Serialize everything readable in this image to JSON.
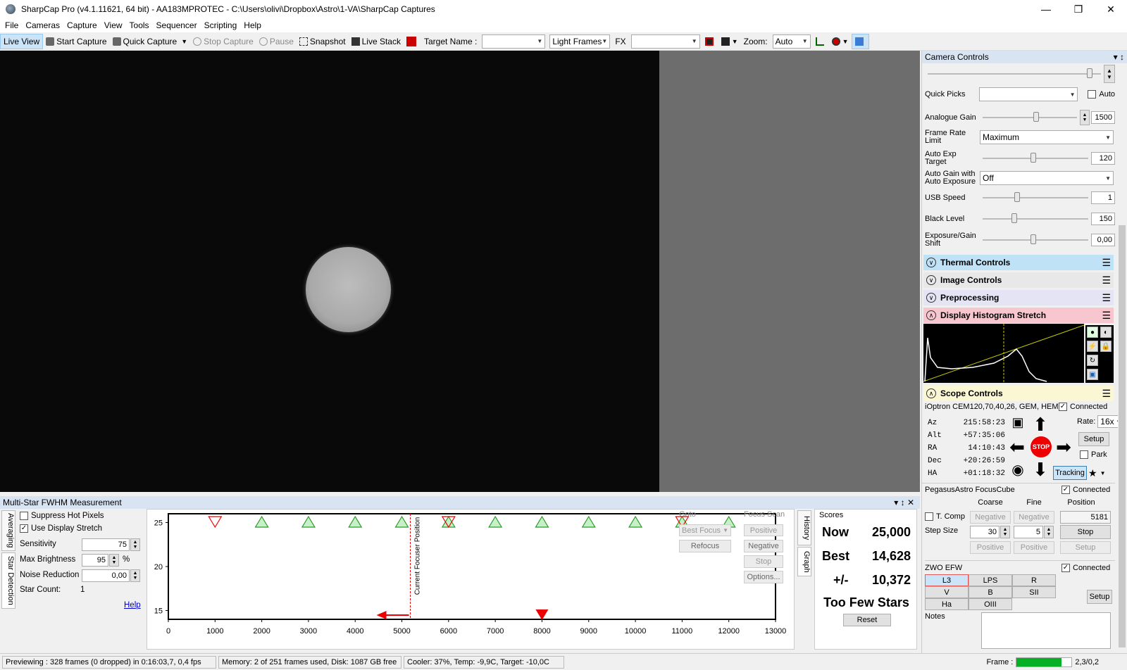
{
  "window": {
    "title": "SharpCap Pro (v4.1.11621, 64 bit) - AA183MPROTEC - C:\\Users\\olivi\\Dropbox\\Astro\\1-VA\\SharpCap Captures"
  },
  "menu": [
    "File",
    "Cameras",
    "Capture",
    "View",
    "Tools",
    "Sequencer",
    "Scripting",
    "Help"
  ],
  "toolbar": {
    "live_view": "Live View",
    "start_capture": "Start Capture",
    "quick_capture": "Quick Capture",
    "stop_capture": "Stop Capture",
    "pause": "Pause",
    "snapshot": "Snapshot",
    "live_stack": "Live Stack",
    "target_name_label": "Target Name :",
    "target_name_value": "",
    "frame_type": "Light Frames",
    "fx_label": "FX",
    "fx_value": "",
    "zoom_label": "Zoom:",
    "zoom_value": "Auto"
  },
  "camera_controls": {
    "title": "Camera Controls",
    "quick_picks_label": "Quick Picks",
    "auto_label": "Auto",
    "rows": [
      {
        "label": "Analogue Gain",
        "value": "1500",
        "level": 0.6
      },
      {
        "label": "Auto Exp Target",
        "value": "120",
        "level": 0.5
      },
      {
        "label": "USB Speed",
        "value": "1",
        "level": 0.33
      },
      {
        "label": "Black Level",
        "value": "150",
        "level": 0.3
      },
      {
        "label": "Exposure/Gain Shift",
        "value": "0,00",
        "level": 0.5
      }
    ],
    "frame_rate_label": "Frame Rate Limit",
    "frame_rate_value": "Maximum",
    "auto_gain_label": "Auto Gain with Auto Exposure",
    "auto_gain_value": "Off"
  },
  "sections": {
    "thermal": "Thermal Controls",
    "image": "Image Controls",
    "preprocessing": "Preprocessing",
    "histogram": "Display Histogram Stretch",
    "scope": "Scope Controls"
  },
  "scope": {
    "mount": "iOptron CEM120,70,40,26, GEM, HEM",
    "connected": "Connected",
    "az_label": "Az",
    "az": "215:58:23",
    "alt_label": "Alt",
    "alt": "+57:35:06",
    "ra_label": "RA",
    "ra": "14:10:43",
    "dec_label": "Dec",
    "dec": "+20:26:59",
    "ha_label": "HA",
    "ha": "+01:18:32",
    "rate_label": "Rate:",
    "rate": "16x",
    "setup": "Setup",
    "park": "Park",
    "tracking": "Tracking",
    "stop": "STOP"
  },
  "focuser": {
    "name": "PegasusAstro FocusCube",
    "connected": "Connected",
    "coarse": "Coarse",
    "fine": "Fine",
    "position_label": "Position",
    "tcomp": "T. Comp",
    "negative": "Negative",
    "positive": "Positive",
    "position": "5181",
    "step_size_label": "Step Size",
    "coarse_step": "30",
    "fine_step": "5",
    "stop": "Stop",
    "setup": "Setup"
  },
  "filter_wheel": {
    "name": "ZWO EFW",
    "connected": "Connected",
    "filters": [
      "L3",
      "LPS",
      "R",
      "V",
      "B",
      "SII",
      "Ha",
      "OIII"
    ],
    "selected": "L3",
    "setup": "Setup",
    "notes_label": "Notes"
  },
  "fwhm": {
    "title": "Multi-Star FWHM Measurement",
    "side_tabs": [
      "Averaging",
      "Star Detection"
    ],
    "suppress_hot_pixels": "Suppress Hot Pixels",
    "use_display_stretch": "Use Display Stretch",
    "sensitivity_label": "Sensitivity",
    "sensitivity": "75",
    "max_brightness_label": "Max Brightness",
    "max_brightness": "95",
    "percent": "%",
    "noise_reduction_label": "Noise Reduction",
    "noise_reduction": "0,00",
    "star_count_label": "Star Count:",
    "star_count": "1",
    "help": "Help",
    "current_focuser_position": "Current Focuser Position",
    "goto": "Goto",
    "best_focus": "Best Focus",
    "refocus": "Refocus",
    "focus_scan": "Focus Scan",
    "positive": "Positive",
    "negative": "Negative",
    "stop": "Stop",
    "options": "Options...",
    "right_tabs": [
      "History",
      "Graph"
    ],
    "scores_label": "Scores",
    "now_label": "Now",
    "now": "25,000",
    "best_label": "Best",
    "best": "14,628",
    "pm_label": "+/-",
    "pm": "10,372",
    "status": "Too Few Stars",
    "reset": "Reset"
  },
  "chart_data": {
    "type": "scatter",
    "x_ticks": [
      "0",
      "1000",
      "2000",
      "3000",
      "4000",
      "5000",
      "6000",
      "7000",
      "8000",
      "9000",
      "10000",
      "11000",
      "12000",
      "13000"
    ],
    "y_ticks": [
      "15",
      "20",
      "25"
    ],
    "xlim": [
      0,
      13000
    ],
    "ylim": [
      14,
      26
    ],
    "current_position": 5181,
    "points_up": [
      2000,
      3000,
      4000,
      5000,
      6000,
      7000,
      8000,
      9000,
      10000,
      11000,
      12000
    ],
    "points_down": [
      1000,
      6000,
      11000
    ],
    "best_marker": 8000
  },
  "status": {
    "previewing": "Previewing : 328 frames (0 dropped) in 0:16:03,7, 0,4 fps",
    "memory": "Memory: 2 of 251 frames used, Disk: 1087 GB free",
    "cooler": "Cooler: 37%, Temp: -9,9C, Target: -10,0C",
    "frame_label": "Frame :",
    "frame_value": "2,3/0,2",
    "frame_progress": 0.82
  }
}
